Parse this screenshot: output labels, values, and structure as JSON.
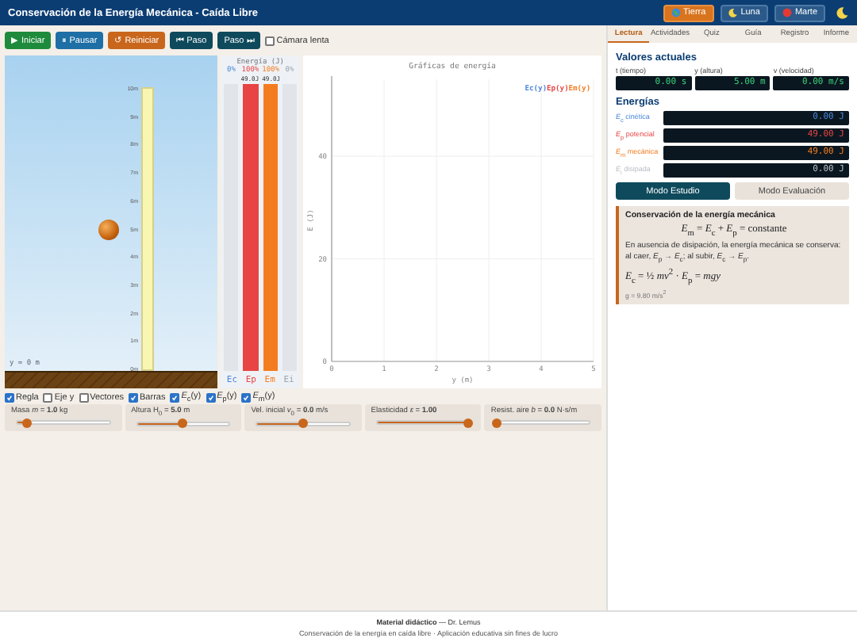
{
  "header": {
    "title": "Conservación de la Energía Mecánica - Caída Libre",
    "planets": [
      {
        "label": "Tierra",
        "selected": true
      },
      {
        "label": "Luna",
        "selected": false
      },
      {
        "label": "Marte",
        "selected": false
      }
    ]
  },
  "toolbar": {
    "buttons": [
      {
        "label": "▶ Iniciar",
        "color": "#1e8a3c"
      },
      {
        "label": "⏸ Pausar",
        "color": "#1d6fa5"
      },
      {
        "label": "↺ Reiniciar",
        "color": "#c8661c"
      },
      {
        "label": "⏮ Paso",
        "color": "#0e4a5c"
      },
      {
        "label": "Paso ⏭",
        "color": "#0e4a5c"
      }
    ],
    "slow_camera": {
      "label": "Cámara lenta",
      "checked": false
    }
  },
  "scene": {
    "ruler_ticks": [
      "10m",
      "9m",
      "8m",
      "7m",
      "6m",
      "5m",
      "4m",
      "3m",
      "2m",
      "1m",
      "0m"
    ],
    "ground_label": "y = 0 m"
  },
  "energy_bars": {
    "title": "Energía (J)",
    "bars": [
      {
        "label": "Ec",
        "percent": "0%",
        "level": 0,
        "color": "#4a86d8"
      },
      {
        "label": "Ep",
        "percent": "100%",
        "value": "49.0J",
        "level": 1,
        "color": "#e84444"
      },
      {
        "label": "Em",
        "percent": "100%",
        "value": "49.0J",
        "level": 1,
        "color": "#f47c20"
      },
      {
        "label": "Ei",
        "percent": "0%",
        "level": 0,
        "color": "#9aa3ad"
      }
    ]
  },
  "chart": {
    "chart_data": {
      "type": "line",
      "title": "Gráficas de energía",
      "xlabel": "y (m)",
      "ylabel": "E (J)",
      "grid": true,
      "categories": [
        "0",
        "1",
        "2",
        "3",
        "4",
        "5"
      ],
      "ylim": [
        0,
        55
      ],
      "yticks": [
        0,
        20,
        40
      ],
      "series": [
        {
          "name": "Ec(y)",
          "color": "#4a86d8",
          "values": [
            null,
            null,
            null,
            null,
            null,
            null
          ]
        },
        {
          "name": "Ep(y)",
          "color": "#e84444",
          "values": [
            null,
            null,
            null,
            null,
            null,
            null
          ]
        },
        {
          "name": "Em(y)",
          "color": "#f47c20",
          "values": [
            null,
            null,
            null,
            null,
            null,
            null
          ]
        }
      ]
    }
  },
  "options": [
    {
      "label": "Regla",
      "checked": true
    },
    {
      "label": "Eje y",
      "checked": false
    },
    {
      "label": "Vectores",
      "checked": false
    },
    {
      "label": "Barras",
      "checked": true
    },
    {
      "label": "*E*$_{c}$(y)",
      "checked": true
    },
    {
      "label": "*E*$_{p}$(y)",
      "checked": true
    },
    {
      "label": "*E*$_{m}$(y)",
      "checked": true
    }
  ],
  "sliders": [
    {
      "label": "Masa *m* = **1.0** kg",
      "level": 0.1
    },
    {
      "label": "Altura H$_{0}$ = **5.0** m",
      "level": 0.5
    },
    {
      "label": "Vel. inicial *v*$_{0}$ = **0.0** m/s",
      "level": 0.5
    },
    {
      "label": "Elasticidad *ε* = **1.00**",
      "level": 1
    },
    {
      "label": "Resist. aire *b* = **0.0** N·s/m",
      "level": 0
    }
  ],
  "panel": {
    "tabs": [
      {
        "label": "Lectura",
        "selected": true
      },
      {
        "label": "Actividades",
        "selected": false
      },
      {
        "label": "Quiz",
        "selected": false
      },
      {
        "label": "Guía",
        "selected": false
      },
      {
        "label": "Registro",
        "selected": false
      },
      {
        "label": "Informe",
        "selected": false
      }
    ],
    "current_title": "Valores actuales",
    "readouts": [
      {
        "label": "t (tiempo)",
        "value": "0.00 s"
      },
      {
        "label": "y (altura)",
        "value": "5.00 m"
      },
      {
        "label": "v (velocidad)",
        "value": "0.00 m/s"
      }
    ],
    "energies_title": "Energías",
    "energies": [
      {
        "label": "*E*$_{c}$ cinética",
        "value": "0.00 J"
      },
      {
        "label": "*E*$_{p}$ potencial",
        "value": "49.00 J"
      },
      {
        "label": "*E*$_{m}$ mecánica",
        "value": "49.00 J"
      },
      {
        "label": "*E*$_{i}$ disipada",
        "value": "0.00 J"
      }
    ],
    "modes": [
      {
        "label": "Modo Estudio",
        "selected": true
      },
      {
        "label": "Modo Evaluación",
        "selected": false
      }
    ],
    "info": {
      "title": "Conservación de la energía mecánica",
      "formula": "*E*$_{m}$ = *E*$_{c}$ + *E*$_{p}$ = constante",
      "text": "En ausencia de disipación, la energía mecánica se conserva: al caer, *E*$_{p}$ → *E*$_{c}$; al subir, *E*$_{c}$ → *E*$_{p}$.",
      "formula2": "*E*$_{c}$ = ½ *mv*$^{2}$ · *E*$_{p}$ = *mgy*",
      "note": "g = 9.80 m/s$^{2}$"
    }
  },
  "footer": {
    "line1": "**Material didáctico** — Dr. Lemus",
    "line2": "Conservación de la energía en caída libre · Aplicación educativa sin fines de lucro"
  }
}
